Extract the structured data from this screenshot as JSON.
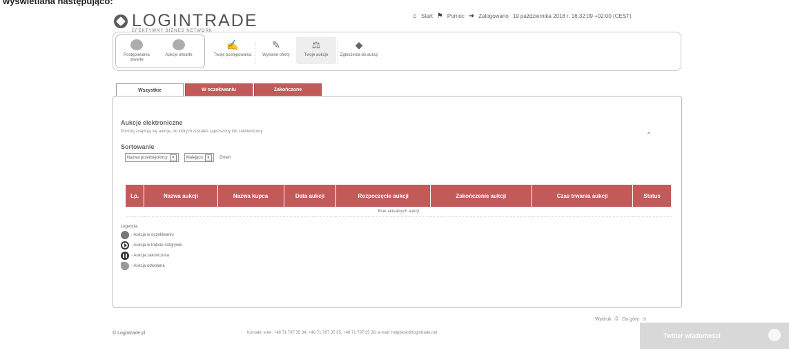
{
  "caption": "wyświetlana następująco:",
  "logo": {
    "name": "LOGINTRADE",
    "sub": "EFEKTYWNY BIZNES NETWORK"
  },
  "topnav": {
    "start": "Start",
    "help": "Pomoc",
    "user_label": "Zalogowano",
    "datetime": "19 października 2018 r. 16:32:09 +02:00 (CEST)"
  },
  "toolbar": {
    "items": [
      "Postępowania otwarte",
      "Aukcje otwarte",
      "Twoje postępowania",
      "Wysłane oferty",
      "Twoje aukcje",
      "Zgłoszenia do aukcji"
    ]
  },
  "tabs": [
    "Wszystkie",
    "W oczekiwaniu",
    "Zakończone"
  ],
  "panel": {
    "title": "Aukcje elektroniczne",
    "desc": "Poniżej znajdują się aukcje, do których zostałeś zaproszony lub zatwierdzony",
    "sort_title": "Sortowanie",
    "sort_field": "Nazwa przedsiębiorcy",
    "sort_order": "Malejąco",
    "apply": "Zmień",
    "collapse": "⌃"
  },
  "table": {
    "headers": [
      "Lp.",
      "Nazwa aukcji",
      "Nazwa kupca",
      "Data aukcji",
      "Rozpoczęcie aukcji",
      "Zakończenie aukcji",
      "Czas trwania aukcji",
      "Status"
    ],
    "empty": "Brak aktualnych aukcji"
  },
  "legend": {
    "title": "Legenda:",
    "items": [
      "- Aukcja w oczekiwaniu",
      "- Aukcja w trakcie rozgrywki",
      "- Aukcja zakończona",
      "- Aukcja odwołana"
    ]
  },
  "footer": {
    "print": "Wydruk",
    "top": "Do góry",
    "copyright": "© Logintrade.pl",
    "contact": "Kontakt: e-tel. +48 71 787 35 34, +48 71 787 35 35, +48 71 787 35 36; e-mail: helpdesk@logintrade.net",
    "message_button": "Twitter wiadomości"
  }
}
